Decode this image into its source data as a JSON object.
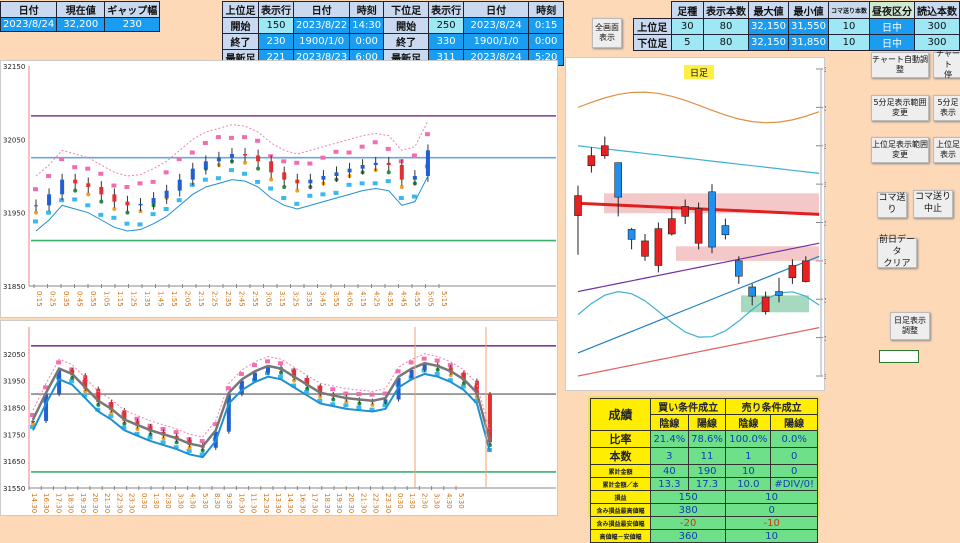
{
  "summary": {
    "headers": [
      "日付",
      "現在値",
      "ギャップ幅"
    ],
    "values": [
      "2023/8/24",
      "32,200",
      "230"
    ]
  },
  "range_table": {
    "headers": [
      "上位足",
      "表示行",
      "日付",
      "時刻",
      "下位足",
      "表示行",
      "日付",
      "時刻"
    ],
    "rows": [
      [
        "開始",
        "150",
        "2023/8/22",
        "14:30",
        "開始",
        "250",
        "2023/8/24",
        "0:15"
      ],
      [
        "終了",
        "230",
        "1900/1/0",
        "0:00",
        "終了",
        "330",
        "1900/1/0",
        "0:00"
      ],
      [
        "最新足",
        "221",
        "2023/8/23",
        "6:00",
        "最新足",
        "311",
        "2023/8/24",
        "5:20"
      ]
    ]
  },
  "fullscreen_button": "全画面\n表示",
  "settings_table": {
    "headers": [
      "足種",
      "表示本数",
      "最大値",
      "最小値",
      "コマ送り本数",
      "昼夜区分",
      "読込本数"
    ],
    "rows": [
      {
        "label": "上位足",
        "values": [
          "30",
          "80",
          "32,150",
          "31,550",
          "10",
          "日中",
          "300"
        ]
      },
      {
        "label": "下位足",
        "values": [
          "5",
          "80",
          "32,150",
          "31,850",
          "10",
          "日中",
          "300"
        ]
      }
    ]
  },
  "buttons": [
    "チャート自動調整",
    "チャート\n停",
    "5分足表示範囲変更",
    "5分足\n表示",
    "上位足表示範囲変更",
    "上位足\n表示",
    "コマ送り",
    "コマ送り\n中止",
    "前日データ\nクリア",
    "日足表示調整"
  ],
  "results": {
    "title": "成績",
    "buy_header": "買い条件成立",
    "sell_header": "売り条件成立",
    "sub_headers": [
      "陰線",
      "陽線",
      "陰線",
      "陽線"
    ],
    "rows": [
      {
        "label": "比率",
        "values": [
          "21.4%",
          "78.6%",
          "100.0%",
          "0.0%"
        ]
      },
      {
        "label": "本数",
        "values": [
          "3",
          "11",
          "1",
          "0"
        ]
      },
      {
        "label": "累計金額",
        "values": [
          "40",
          "190",
          "10",
          "0"
        ]
      },
      {
        "label": "累計金額／本",
        "values": [
          "13.3",
          "17.3",
          "10.0",
          "#DIV/0!"
        ]
      },
      {
        "label": "損益",
        "values": [
          "150",
          "10"
        ]
      },
      {
        "label": "含み損益最高値幅",
        "values": [
          "380",
          "0"
        ]
      },
      {
        "label": "含み損益最安値幅",
        "values": [
          "-20",
          "-10"
        ]
      },
      {
        "label": "高値幅－安値幅",
        "values": [
          "360",
          "10"
        ]
      }
    ]
  },
  "chart_data": [
    {
      "type": "candlestick",
      "name": "5分足",
      "ylim": [
        31850,
        32150
      ],
      "yticks": [
        "32150",
        "32050",
        "31950",
        "31850"
      ],
      "xticks": [
        "0:15",
        "0:25",
        "0:35",
        "0:45",
        "0:55",
        "1:05",
        "1:15",
        "1:25",
        "1:35",
        "1:45",
        "1:55",
        "2:05",
        "2:15",
        "2:25",
        "2:35",
        "2:45",
        "2:55",
        "3:05",
        "3:15",
        "3:25",
        "3:35",
        "3:45",
        "3:55",
        "4:05",
        "4:15",
        "4:25",
        "4:35",
        "4:45",
        "4:55",
        "5:05",
        "5:15"
      ],
      "closes": [
        31960,
        31975,
        31995,
        31990,
        31985,
        31975,
        31965,
        31960,
        31962,
        31970,
        31980,
        31995,
        32010,
        32020,
        32025,
        32030,
        32028,
        32020,
        32005,
        31995,
        31990,
        31995,
        32000,
        32005,
        32010,
        32015,
        32018,
        32015,
        31995,
        32000,
        32035
      ],
      "lines": {
        "purple": 32082,
        "blue": 32025,
        "green": 31912
      }
    },
    {
      "type": "candlestick",
      "name": "30分足",
      "ylim": [
        31550,
        32150
      ],
      "yticks": [
        "32050",
        "31950",
        "31850",
        "31750",
        "31650",
        "31550"
      ],
      "xticks": [
        "14:30",
        "16:30",
        "17:30",
        "18:30",
        "19:30",
        "20:30",
        "21:30",
        "22:30",
        "23:30",
        "0:30",
        "1:30",
        "2:30",
        "3:30",
        "4:30",
        "5:30",
        "8:30",
        "9:30",
        "10:30",
        "11:30",
        "12:30",
        "13:30",
        "14:30",
        "16:30",
        "17:30",
        "18:30",
        "19:30",
        "20:30",
        "21:30",
        "22:30",
        "23:30",
        "0:30",
        "1:30",
        "2:30",
        "3:30",
        "4:30",
        "5:30"
      ],
      "closes": [
        31800,
        31900,
        31990,
        31970,
        31920,
        31870,
        31840,
        31800,
        31780,
        31760,
        31745,
        31730,
        31710,
        31700,
        31760,
        31900,
        31950,
        31980,
        32000,
        31990,
        31960,
        31930,
        31900,
        31890,
        31880,
        31875,
        31870,
        31880,
        31960,
        31990,
        32010,
        32000,
        31980,
        31950,
        31900,
        31720
      ],
      "lines": {
        "purple": 32080,
        "gray": 31900,
        "green": 31610
      }
    },
    {
      "type": "candlestick",
      "name": "日足",
      "title": "日足",
      "ylim": [
        30400,
        34400
      ],
      "yticks": [
        "34,400",
        "33,900",
        "33,400",
        "32,900",
        "32,400",
        "31,900",
        "31,400",
        "30,900",
        "30,400"
      ],
      "ohlc": [
        [
          32750,
          32880,
          31980,
          32490
        ],
        [
          33270,
          33380,
          33050,
          33140
        ],
        [
          33400,
          33520,
          33230,
          33270
        ],
        [
          32730,
          33050,
          32480,
          33180
        ],
        [
          32180,
          32330,
          32050,
          32310
        ],
        [
          32160,
          32250,
          31900,
          31960
        ],
        [
          32320,
          32400,
          31750,
          31840
        ],
        [
          32450,
          32600,
          32230,
          32250
        ],
        [
          32610,
          32700,
          32380,
          32480
        ],
        [
          32580,
          32660,
          32050,
          32130
        ],
        [
          32080,
          32900,
          32000,
          32800
        ],
        [
          32240,
          32450,
          32180,
          32360
        ],
        [
          31700,
          31960,
          31600,
          31900
        ],
        [
          31440,
          31600,
          31320,
          31560
        ],
        [
          31430,
          31500,
          31200,
          31240
        ],
        [
          31450,
          31680,
          31360,
          31500
        ],
        [
          31840,
          31920,
          31600,
          31680
        ],
        [
          31900,
          31960,
          31620,
          31630
        ]
      ]
    }
  ]
}
